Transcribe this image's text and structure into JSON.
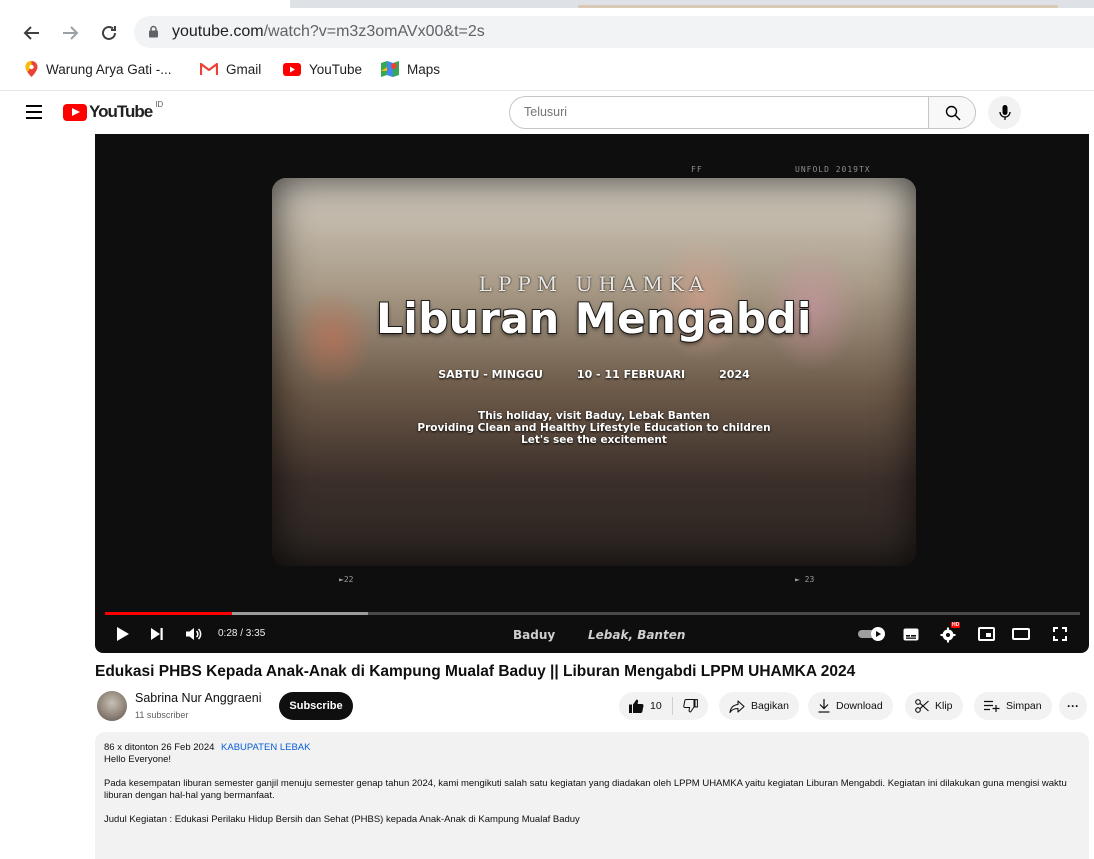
{
  "browser": {
    "url_host": "youtube.com",
    "url_path": "/watch?v=m3z3omAVx00&t=2s",
    "bookmarks": [
      "Warung Arya Gati -...",
      "Gmail",
      "YouTube",
      "Maps"
    ]
  },
  "header": {
    "logo": "YouTube",
    "country_code": "ID",
    "search_placeholder": "Telusuri"
  },
  "player": {
    "film_label_left": "FF",
    "film_label_right": "UNFOLD 2019TX",
    "overlay_brand": "LPPM UHAMKA",
    "overlay_title": "Liburan Mengabdi",
    "overlay_days": "SABTU - MINGGU",
    "overlay_dates": "10 - 11 FEBRUARI",
    "overlay_year": "2024",
    "overlay_line1": "This holiday, visit Baduy, Lebak Banten",
    "overlay_line2": "Providing Clean and Healthy Lifestyle Education to children",
    "overlay_line3": "Let's see the excitement",
    "film_num_left": "►22",
    "film_num_right": "► 23",
    "time": "0:28 / 3:35",
    "progress_fraction": 0.13,
    "location_a": "Baduy",
    "location_b": "Lebak, Banten",
    "settings_badge": "HD"
  },
  "video": {
    "title": "Edukasi PHBS Kepada Anak-Anak di Kampung Mualaf Baduy || Liburan Mengabdi LPPM UHAMKA 2024",
    "channel_name": "Sabrina Nur Anggraeni",
    "subscribers": "11 subscriber",
    "subscribe_label": "Subscribe",
    "like_count": "10",
    "share_label": "Bagikan",
    "download_label": "Download",
    "clip_label": "Klip",
    "save_label": "Simpan",
    "more_label": "···"
  },
  "description": {
    "views": "86 x ditonton",
    "date": "26 Feb 2024",
    "tag": "KABUPATEN LEBAK",
    "line1": "Hello Everyone!",
    "para1": "Pada kesempatan liburan semester ganjil menuju semester genap tahun 2024, kami mengikuti salah satu kegiatan yang diadakan oleh LPPM UHAMKA yaitu kegiatan Liburan Mengabdi. Kegiatan ini dilakukan guna mengisi waktu liburan dengan hal-hal yang bermanfaat.",
    "para2": "Judul Kegiatan : Edukasi Perilaku Hidup Bersih dan Sehat (PHBS) kepada Anak-Anak di Kampung Mualaf Baduy"
  },
  "colors": {
    "accent": "#ff0000",
    "link": "#065fd4",
    "subscribe_bg": "#0f0f0f",
    "pill_bg": "#f2f2f2"
  }
}
